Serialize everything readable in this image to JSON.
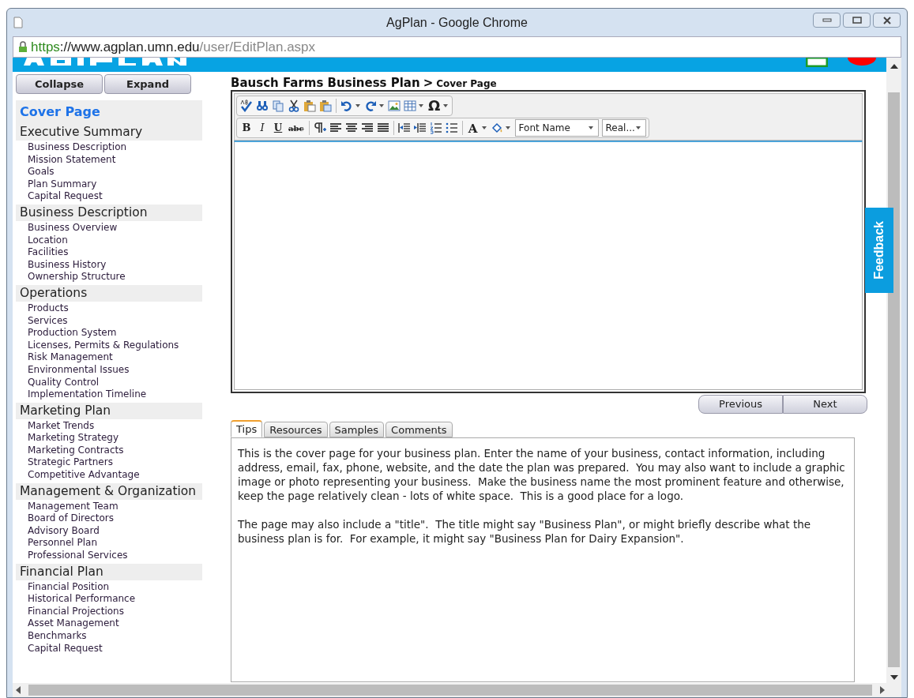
{
  "window": {
    "title": "AgPlan - Google Chrome"
  },
  "address_bar": {
    "scheme": "https",
    "host": "://www.agplan.umn.edu",
    "path": "/user/EditPlan.aspx"
  },
  "sidebar": {
    "buttons": [
      "Collapse",
      "Expand"
    ],
    "cover": {
      "label": "Cover Page",
      "selected": true
    },
    "sections": [
      {
        "title": "Executive Summary",
        "items": [
          "Business Description",
          "Mission Statement",
          "Goals",
          "Plan Summary",
          "Capital Request"
        ]
      },
      {
        "title": "Business Description",
        "items": [
          "Business Overview",
          "Location",
          "Facilities",
          "Business History",
          "Ownership Structure"
        ]
      },
      {
        "title": "Operations",
        "items": [
          "Products",
          "Services",
          "Production System",
          "Licenses, Permits & Regulations",
          "Risk Management",
          "Environmental Issues",
          "Quality Control",
          "Implementation Timeline"
        ]
      },
      {
        "title": "Marketing Plan",
        "items": [
          "Market Trends",
          "Marketing Strategy",
          "Marketing Contracts",
          "Strategic Partners",
          "Competitive Advantage"
        ]
      },
      {
        "title": "Management & Organization",
        "items": [
          "Management Team",
          "Board of Directors",
          "Advisory Board",
          "Personnel Plan",
          "Professional Services"
        ]
      },
      {
        "title": "Financial Plan",
        "items": [
          "Financial Position",
          "Historical Performance",
          "Financial Projections",
          "Asset Management",
          "Benchmarks",
          "Capital Request"
        ]
      }
    ]
  },
  "breadcrumb": {
    "plan": "Bausch Farms Business Plan",
    "separator": ">",
    "page": "Cover Page"
  },
  "editor": {
    "glyphs": [
      "Ω",
      "B",
      "I",
      "U",
      "abc",
      "A"
    ],
    "font_name": "Font Name",
    "font_size": "Real..."
  },
  "nav_buttons": [
    "Previous",
    "Next"
  ],
  "tabs": [
    {
      "label": "Tips",
      "selected": true
    },
    {
      "label": "Resources",
      "selected": false
    },
    {
      "label": "Samples",
      "selected": false
    },
    {
      "label": "Comments",
      "selected": false
    }
  ],
  "tips": [
    "This is the cover page for your business plan. Enter the name of your business, contact information, including address, email, fax, phone, website, and the date the plan was prepared.  You may also want to include a graphic image or photo representing your business.  Make the business name the most prominent feature and otherwise, keep the page relatively clean - lots of white space.  This is a good place for a logo.",
    "The page may also include a \"title\".  The title might say \"Business Plan\", or might briefly describe what the business plan is for.  For example, it might say \"Business Plan for Dairy Expansion\"."
  ],
  "feedback": "Feedback"
}
